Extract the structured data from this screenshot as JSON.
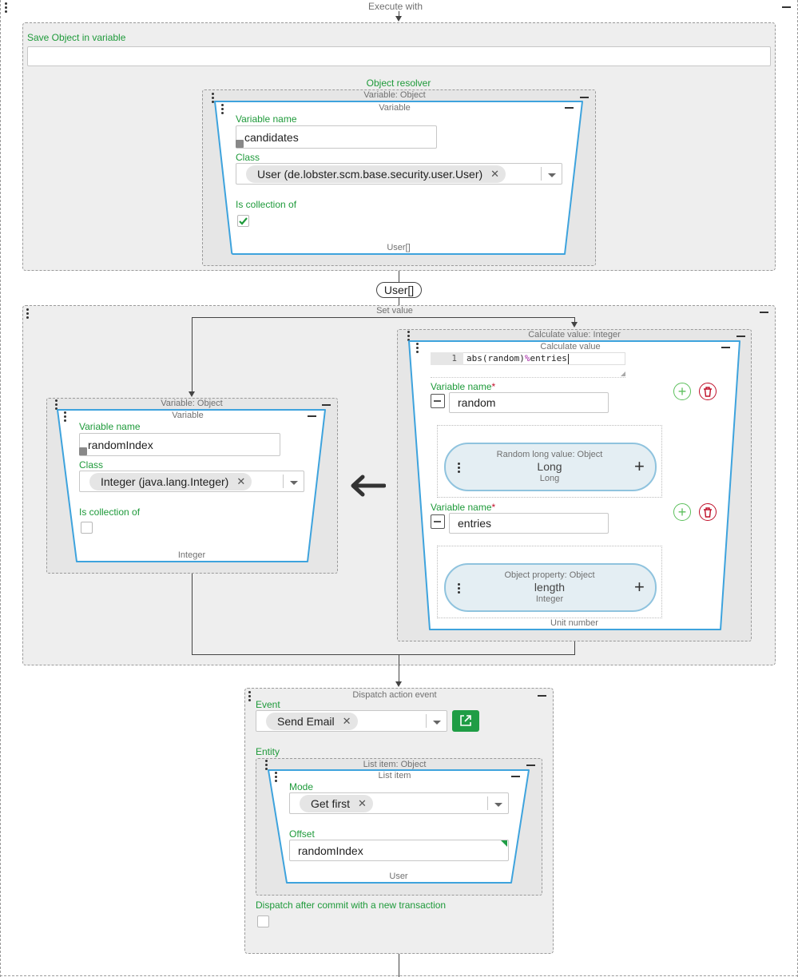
{
  "top": {
    "execute_with": "Execute with"
  },
  "save_block": {
    "label": "Save Object in variable",
    "input_value": "",
    "object_resolver": "Object resolver",
    "outer_title": "Variable: Object",
    "inner_title": "Variable",
    "varname_label": "Variable name",
    "varname_value": "candidates",
    "class_label": "Class",
    "class_chip": "User (de.lobster.scm.base.security.user.User)",
    "is_collection_label": "Is collection of",
    "is_collection_checked": true,
    "footer": "User[]"
  },
  "connector_badge": "User[]",
  "set_value": {
    "title": "Set value",
    "left": {
      "outer_title": "Variable: Object",
      "inner_title": "Variable",
      "varname_label": "Variable name",
      "varname_value": "randomIndex",
      "class_label": "Class",
      "class_chip": "Integer (java.lang.Integer)",
      "is_collection_label": "Is collection of",
      "is_collection_checked": false,
      "footer": "Integer"
    },
    "right": {
      "outer_title": "Calculate value: Integer",
      "inner_title": "Calculate value",
      "code_line_no": "1",
      "code_part1": "abs(random)",
      "code_op": "%",
      "code_part2": "entries",
      "var1_label": "Variable name",
      "var1_value": "random",
      "var1_resolver_title": "Random long value: Object",
      "var1_resolver_name": "Long",
      "var1_resolver_type": "Long",
      "var2_label": "Variable name",
      "var2_value": "entries",
      "var2_resolver_title": "Object property: Object",
      "var2_resolver_name": "length",
      "var2_resolver_type": "Integer",
      "footer": "Unit number"
    }
  },
  "dispatch": {
    "title": "Dispatch action event",
    "event_label": "Event",
    "event_chip": "Send Email",
    "entity_label": "Entity",
    "list_outer_title": "List item: Object",
    "list_inner_title": "List item",
    "mode_label": "Mode",
    "mode_chip": "Get first",
    "offset_label": "Offset",
    "offset_value": "randomIndex",
    "list_footer": "User",
    "after_commit_label": "Dispatch after commit with a new transaction",
    "after_commit_checked": false
  },
  "icons": {
    "external_link": "external-link-icon",
    "add": "add-circle-icon",
    "delete": "trash-icon",
    "left_arrow": "arrow-left-icon"
  },
  "colors": {
    "accent_green": "#1e9a3a",
    "border_blue": "#3ea3dd",
    "danger_red": "#c0102a",
    "button_green": "#1f9d45"
  }
}
